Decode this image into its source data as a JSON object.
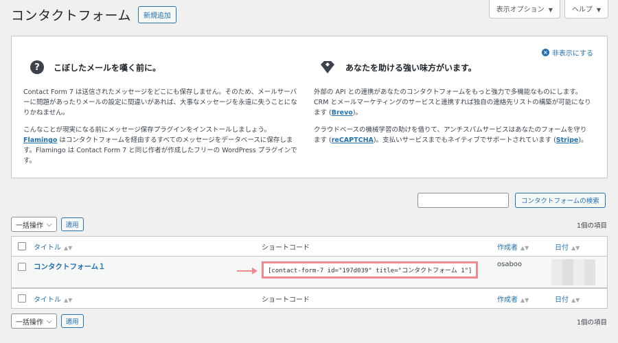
{
  "page": {
    "title": "コンタクトフォーム",
    "add_new_label": "新規追加"
  },
  "screen_meta": {
    "options_label": "表示オプション",
    "help_label": "ヘルプ"
  },
  "welcome": {
    "dismiss_label": "非表示にする",
    "left": {
      "icon": "question-icon",
      "title": "こぼしたメールを嘆く前に。",
      "p1": "Contact Form 7 は送信されたメッセージをどこにも保存しません。そのため、メールサーバーに問題があったりメールの設定に間違いがあれば、大事なメッセージを永遠に失うことになりかねません。",
      "p2_link": "Flamingo",
      "p2_pre": "こんなことが現実になる前にメッセージ保存プラグインをインストールしましょう。",
      "p2_post": " はコンタクトフォームを経由するすべてのメッセージをデータベースに保存します。Flamingo は Contact Form 7 と同じ作者が作成したフリーの WordPress プラグインです。"
    },
    "right": {
      "icon": "gem-icon",
      "title": "あなたを助ける強い味方がいます。",
      "p1_pre": "外部の API との連携があなたのコンタクトフォームをもっと強力で多機能なものにします。CRM とメールマーケティングのサービスと連携すれば独自の連絡先リストの構築が可能になります (",
      "p1_link": "Brevo",
      "p1_post": ")。",
      "p2_pre": "クラウドベースの機械学習の助けを借りて、アンチスパムサービスはあなたのフォームを守ります (",
      "p2_link1": "reCAPTCHA",
      "p2_mid": ")。支払いサービスまでもネイティブでサポートされています (",
      "p2_link2": "Stripe",
      "p2_post": ")。"
    }
  },
  "search": {
    "input_value": "",
    "button_label": "コンタクトフォームの検索"
  },
  "bulk_actions": {
    "select_label": "一括操作",
    "apply_label": "適用"
  },
  "item_count": "1個の項目",
  "table": {
    "columns": {
      "title": "タイトル",
      "shortcode": "ショートコード",
      "author": "作成者",
      "date": "日付"
    },
    "rows": [
      {
        "title": "コンタクトフォーム１",
        "shortcode": "[contact-form-7 id=\"197d039\" title=\"コンタクトフォーム 1\"]",
        "author": "osaboo"
      }
    ]
  },
  "colors": {
    "accent": "#2271b1",
    "highlight": "#f0898f"
  }
}
